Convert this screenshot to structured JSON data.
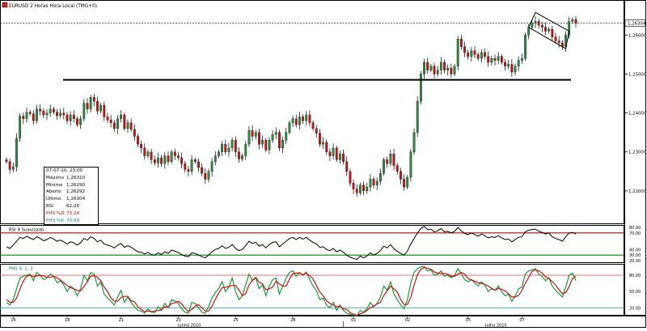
{
  "header": {
    "symbol_icon": "flag-icon",
    "title": "EURUSD 2 Horas Hora Local (TMG+0)"
  },
  "price_axis": {
    "ticks": [
      "1,26000",
      "1,25000",
      "1,24000",
      "1,23000",
      "1,22000"
    ],
    "current": "1,26304"
  },
  "info_box": {
    "date": "07-07-10, 23:00",
    "rows": [
      {
        "label": "Máximo",
        "value": "1,26310"
      },
      {
        "label": "Mínimo",
        "value": "1,26290"
      },
      {
        "label": "Aberto",
        "value": "1,26292"
      },
      {
        "label": "Último",
        "value": "1,26304"
      },
      {
        "label": "RSI",
        "value": "62,26"
      },
      {
        "label": "PHS %D",
        "value": "73,24"
      },
      {
        "label": "PHS %K",
        "value": "70,09"
      }
    ]
  },
  "rsi_panel": {
    "label": "RSI 9 Suavizado",
    "ticks": [
      "80,00",
      "70,00",
      "40,00",
      "30,00",
      "20,00"
    ]
  },
  "stoch_panel": {
    "label": "PHS 9, 1, 3",
    "ticks": [
      "80,00",
      "50,00",
      "20,00"
    ]
  },
  "time_axis": {
    "days": [
      "16",
      "18",
      "21",
      "23",
      "25",
      "28",
      "01",
      "02",
      "05",
      "07"
    ],
    "months": [
      "Junho 2010",
      "Julho 2010"
    ]
  },
  "colors": {
    "up": "#2e8b3e",
    "down": "#cc1111",
    "rsi_upper": "#cc0000",
    "rsi_lower": "#008000",
    "stoch_k": "#1a9a3a",
    "stoch_d": "#d01010"
  },
  "chart_data": [
    {
      "type": "candlestick",
      "title": "EURUSD 2 Horas Hora Local (TMG+0)",
      "ylim": [
        1.2125,
        1.2665
      ],
      "yticks": [
        1.26,
        1.25,
        1.24,
        1.23,
        1.22
      ],
      "last": 1.26304,
      "horizontal_line": 1.2485,
      "close": [
        1.2275,
        1.2255,
        1.2262,
        1.2335,
        1.2392,
        1.2385,
        1.2402,
        1.2398,
        1.238,
        1.241,
        1.2405,
        1.2395,
        1.24,
        1.241,
        1.2402,
        1.2393,
        1.24,
        1.2395,
        1.238,
        1.2395,
        1.2385,
        1.237,
        1.2385,
        1.2425,
        1.241,
        1.244,
        1.243,
        1.2405,
        1.242,
        1.239,
        1.2382,
        1.2375,
        1.236,
        1.2385,
        1.2395,
        1.236,
        1.2375,
        1.2358,
        1.234,
        1.232,
        1.231,
        1.229,
        1.23,
        1.228,
        1.2272,
        1.2285,
        1.227,
        1.229,
        1.2275,
        1.23,
        1.229,
        1.2285,
        1.227,
        1.2255,
        1.225,
        1.228,
        1.2275,
        1.226,
        1.2245,
        1.223,
        1.225,
        1.2275,
        1.229,
        1.23,
        1.232,
        1.23,
        1.231,
        1.233,
        1.23,
        1.2282,
        1.229,
        1.232,
        1.2355,
        1.234,
        1.235,
        1.232,
        1.233,
        1.2305,
        1.233,
        1.2345,
        1.235,
        1.231,
        1.233,
        1.235,
        1.2375,
        1.2385,
        1.237,
        1.239,
        1.238,
        1.2395,
        1.2375,
        1.236,
        1.2348,
        1.232,
        1.2325,
        1.23,
        1.229,
        1.231,
        1.228,
        1.2295,
        1.2275,
        1.225,
        1.222,
        1.2205,
        1.2195,
        1.2215,
        1.22,
        1.221,
        1.223,
        1.2215,
        1.2225,
        1.2245,
        1.228,
        1.227,
        1.2295,
        1.2265,
        1.225,
        1.223,
        1.221,
        1.2235,
        1.23,
        1.235,
        1.243,
        1.25,
        1.253,
        1.251,
        1.252,
        1.25,
        1.251,
        1.253,
        1.251,
        1.2515,
        1.25,
        1.252,
        1.259,
        1.257,
        1.2555,
        1.2545,
        1.256,
        1.255,
        1.254,
        1.2555,
        1.2545,
        1.253,
        1.254,
        1.2535,
        1.2545,
        1.253,
        1.252,
        1.2525,
        1.2505,
        1.252,
        1.2535,
        1.254,
        1.26,
        1.262,
        1.263,
        1.2635,
        1.2625,
        1.262,
        1.261,
        1.2615,
        1.2595,
        1.2585,
        1.258,
        1.257,
        1.26,
        1.2635,
        1.264,
        1.263
      ],
      "open": [
        1.228,
        1.2275,
        1.2255,
        1.2262,
        1.2335,
        1.2392,
        1.2385,
        1.2402,
        1.2398,
        1.238,
        1.241,
        1.2405,
        1.2395,
        1.24,
        1.241,
        1.2402,
        1.2393,
        1.24,
        1.2395,
        1.238,
        1.2395,
        1.2385,
        1.237,
        1.2385,
        1.2425,
        1.241,
        1.244,
        1.243,
        1.2405,
        1.242,
        1.239,
        1.2382,
        1.2375,
        1.236,
        1.2385,
        1.2395,
        1.236,
        1.2375,
        1.2358,
        1.234,
        1.232,
        1.231,
        1.229,
        1.23,
        1.228,
        1.2272,
        1.2285,
        1.227,
        1.229,
        1.2275,
        1.23,
        1.229,
        1.2285,
        1.227,
        1.2255,
        1.225,
        1.228,
        1.2275,
        1.226,
        1.2245,
        1.223,
        1.225,
        1.2275,
        1.229,
        1.23,
        1.232,
        1.23,
        1.231,
        1.233,
        1.23,
        1.2282,
        1.229,
        1.232,
        1.2355,
        1.234,
        1.235,
        1.232,
        1.233,
        1.2305,
        1.233,
        1.2345,
        1.235,
        1.231,
        1.233,
        1.235,
        1.2375,
        1.2385,
        1.237,
        1.239,
        1.238,
        1.2395,
        1.2375,
        1.236,
        1.2348,
        1.232,
        1.2325,
        1.23,
        1.229,
        1.231,
        1.228,
        1.2295,
        1.2275,
        1.225,
        1.222,
        1.2205,
        1.2195,
        1.2215,
        1.22,
        1.221,
        1.223,
        1.2215,
        1.2225,
        1.2245,
        1.228,
        1.227,
        1.2295,
        1.2265,
        1.225,
        1.223,
        1.221,
        1.2235,
        1.23,
        1.235,
        1.243,
        1.25,
        1.253,
        1.251,
        1.252,
        1.25,
        1.251,
        1.253,
        1.251,
        1.2515,
        1.25,
        1.252,
        1.259,
        1.257,
        1.2555,
        1.2545,
        1.256,
        1.255,
        1.254,
        1.2555,
        1.2545,
        1.253,
        1.254,
        1.2535,
        1.2545,
        1.253,
        1.252,
        1.2525,
        1.2505,
        1.252,
        1.2535,
        1.254,
        1.26,
        1.262,
        1.263,
        1.2635,
        1.2625,
        1.262,
        1.261,
        1.2615,
        1.2595,
        1.2585,
        1.258,
        1.257,
        1.26,
        1.2635,
        1.264
      ]
    },
    {
      "type": "line",
      "title": "RSI 9 Suavizado",
      "ylim": [
        20,
        80
      ],
      "reference_lines": [
        70,
        30
      ],
      "values": [
        45,
        42,
        48,
        55,
        62,
        60,
        64,
        61,
        58,
        63,
        60,
        56,
        58,
        62,
        59,
        55,
        57,
        54,
        50,
        54,
        52,
        48,
        52,
        60,
        57,
        63,
        60,
        54,
        57,
        50,
        48,
        46,
        43,
        48,
        51,
        44,
        47,
        44,
        40,
        36,
        35,
        32,
        35,
        31,
        30,
        34,
        31,
        36,
        33,
        39,
        37,
        35,
        31,
        28,
        27,
        34,
        33,
        30,
        27,
        25,
        30,
        36,
        40,
        42,
        47,
        42,
        44,
        49,
        42,
        38,
        40,
        47,
        55,
        51,
        53,
        46,
        49,
        43,
        49,
        53,
        54,
        45,
        50,
        55,
        60,
        62,
        58,
        62,
        59,
        62,
        57,
        53,
        50,
        44,
        45,
        40,
        38,
        42,
        36,
        39,
        35,
        30,
        26,
        24,
        22,
        28,
        25,
        28,
        34,
        30,
        33,
        38,
        46,
        43,
        49,
        41,
        37,
        33,
        30,
        37,
        50,
        60,
        70,
        78,
        82,
        76,
        77,
        72,
        74,
        78,
        72,
        73,
        70,
        73,
        80,
        74,
        69,
        67,
        70,
        67,
        64,
        68,
        65,
        61,
        63,
        62,
        65,
        61,
        58,
        59,
        54,
        58,
        62,
        63,
        72,
        75,
        76,
        77,
        73,
        71,
        68,
        70,
        63,
        60,
        58,
        55,
        63,
        70,
        71,
        68
      ]
    },
    {
      "type": "line",
      "title": "PHS 9, 1, 3",
      "ylim": [
        10,
        95
      ],
      "reference_lines": [
        80,
        50,
        20
      ],
      "series": [
        {
          "name": "PHS %K",
          "values": [
            30,
            25,
            35,
            55,
            75,
            78,
            80,
            82,
            70,
            85,
            80,
            72,
            75,
            82,
            78,
            66,
            70,
            62,
            50,
            60,
            55,
            42,
            55,
            80,
            70,
            85,
            82,
            60,
            68,
            45,
            38,
            32,
            25,
            40,
            52,
            30,
            40,
            30,
            22,
            15,
            14,
            10,
            18,
            12,
            11,
            22,
            16,
            28,
            20,
            35,
            32,
            28,
            18,
            12,
            10,
            30,
            28,
            20,
            12,
            10,
            22,
            38,
            48,
            55,
            68,
            50,
            58,
            75,
            50,
            35,
            42,
            62,
            82,
            70,
            75,
            55,
            62,
            42,
            60,
            72,
            75,
            45,
            60,
            75,
            85,
            88,
            78,
            85,
            80,
            86,
            72,
            60,
            52,
            35,
            38,
            25,
            20,
            30,
            15,
            25,
            15,
            10,
            8,
            6,
            5,
            15,
            12,
            18,
            30,
            22,
            28,
            40,
            60,
            52,
            68,
            45,
            35,
            25,
            18,
            35,
            65,
            85,
            92,
            95,
            96,
            88,
            90,
            80,
            82,
            88,
            78,
            80,
            75,
            80,
            92,
            82,
            72,
            68,
            72,
            66,
            60,
            68,
            62,
            50,
            55,
            52,
            60,
            50,
            42,
            45,
            32,
            42,
            55,
            58,
            82,
            88,
            90,
            92,
            82,
            78,
            70,
            75,
            60,
            52,
            46,
            40,
            58,
            80,
            84,
            70
          ]
        },
        {
          "name": "PHS %D",
          "values": [
            35,
            30,
            30,
            38,
            55,
            69,
            78,
            80,
            77,
            79,
            79,
            79,
            76,
            76,
            78,
            75,
            71,
            66,
            61,
            57,
            55,
            52,
            51,
            59,
            68,
            78,
            79,
            76,
            70,
            58,
            50,
            38,
            32,
            32,
            39,
            41,
            41,
            33,
            31,
            22,
            17,
            13,
            14,
            13,
            14,
            15,
            16,
            22,
            21,
            28,
            29,
            32,
            27,
            19,
            13,
            17,
            23,
            26,
            20,
            14,
            14,
            23,
            36,
            47,
            57,
            58,
            59,
            61,
            61,
            53,
            42,
            46,
            62,
            71,
            76,
            67,
            64,
            53,
            55,
            58,
            69,
            64,
            60,
            60,
            73,
            83,
            84,
            84,
            81,
            84,
            79,
            73,
            61,
            49,
            42,
            33,
            28,
            25,
            22,
            23,
            18,
            17,
            11,
            8,
            6,
            9,
            11,
            15,
            20,
            23,
            27,
            30,
            43,
            51,
            60,
            55,
            49,
            35,
            26,
            26,
            39,
            62,
            81,
            91,
            94,
            93,
            91,
            86,
            84,
            83,
            83,
            82,
            78,
            78,
            82,
            85,
            82,
            74,
            71,
            69,
            66,
            65,
            63,
            60,
            56,
            52,
            56,
            54,
            51,
            46,
            40,
            40,
            43,
            52,
            65,
            76,
            87,
            90,
            88,
            84,
            77,
            74,
            68,
            62,
            53,
            46,
            48,
            59,
            74,
            78
          ]
        }
      ]
    }
  ]
}
